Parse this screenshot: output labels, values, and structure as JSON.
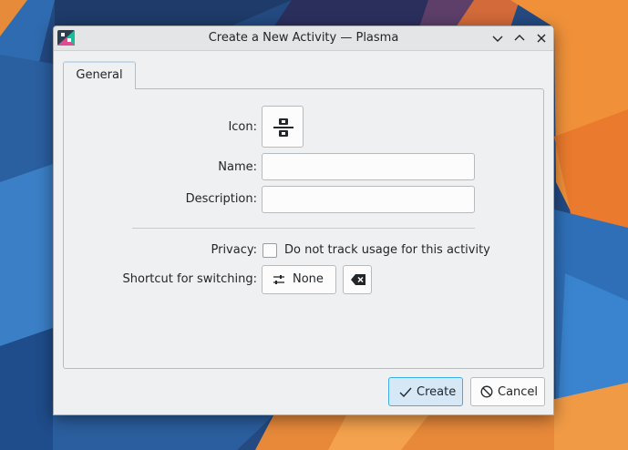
{
  "window": {
    "title": "Create a New Activity — Plasma",
    "controls": [
      "minimize",
      "maximize",
      "close"
    ]
  },
  "tabs": [
    {
      "label": "General",
      "selected": true
    }
  ],
  "form": {
    "icon_label": "Icon:",
    "icon": "activity-icon",
    "name_label": "Name:",
    "name_value": "",
    "description_label": "Description:",
    "description_value": "",
    "privacy_label": "Privacy:",
    "privacy_checkbox_label": "Do not track usage for this activity",
    "privacy_checked": false,
    "shortcut_label": "Shortcut for switching:",
    "shortcut_value": "None",
    "shortcut_icon": "configure-shortcut-icon",
    "clear_icon": "clear-backspace-icon"
  },
  "buttons": {
    "create_label": "Create",
    "cancel_label": "Cancel"
  },
  "colors": {
    "accent": "#3daee9",
    "default_button_bg": "#d6e8f6",
    "window_bg": "#eff0f1"
  }
}
